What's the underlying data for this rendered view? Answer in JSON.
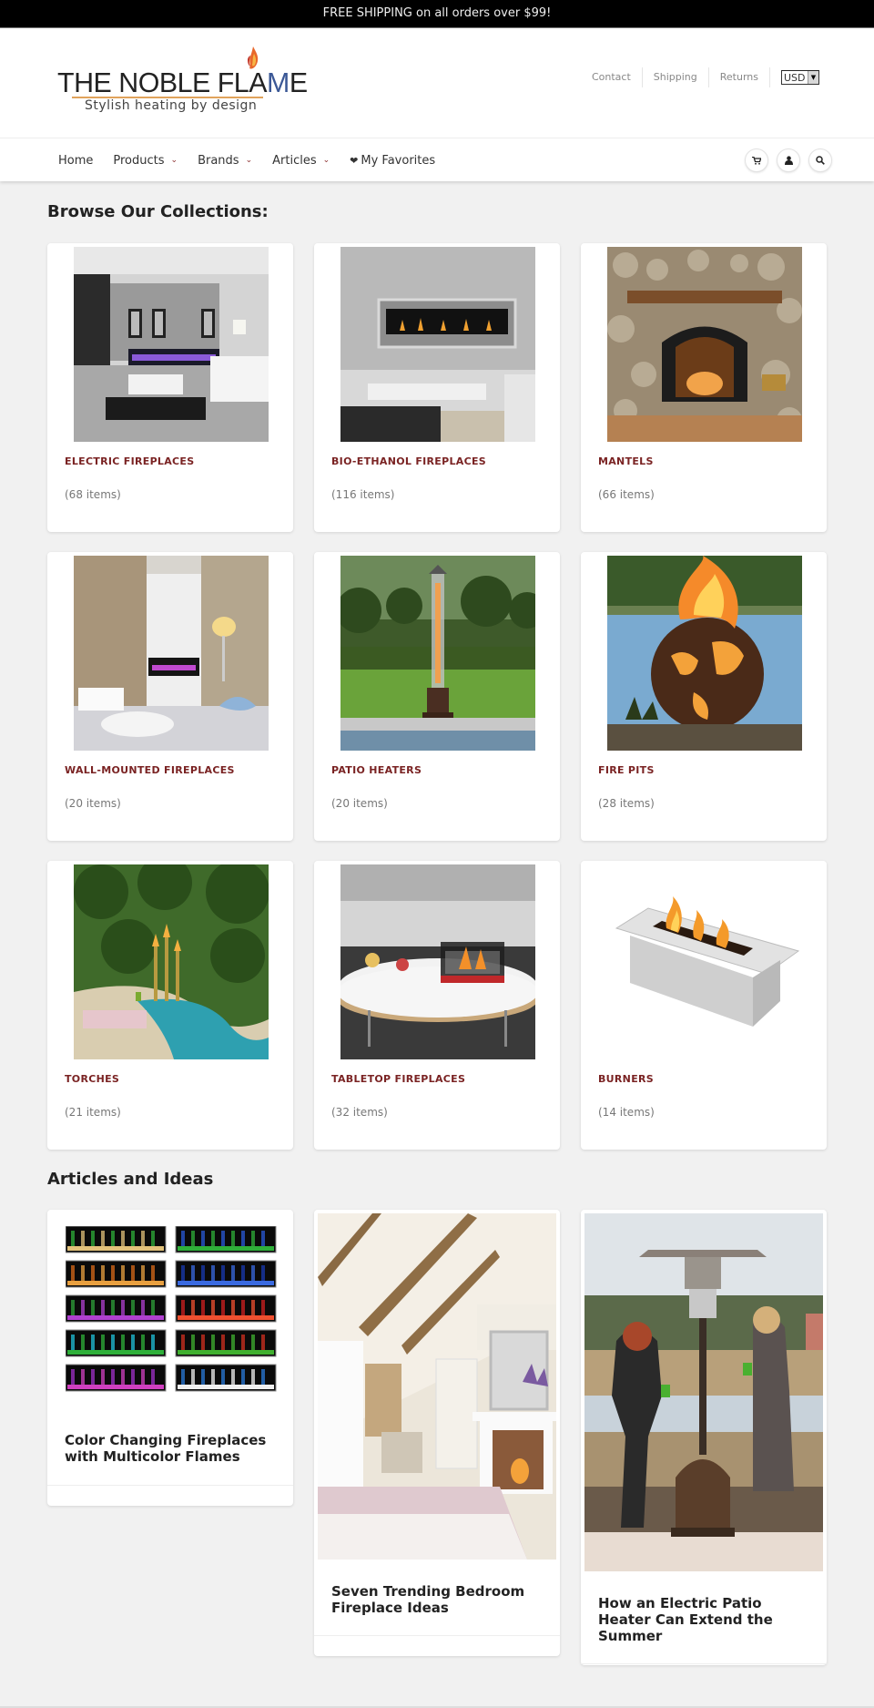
{
  "announcement": "FREE SHIPPING on all orders over $99!",
  "logo": {
    "title_main": "THE NOBLE FLA",
    "title_accent": "M",
    "title_end": "E",
    "tagline": "Stylish heating by design"
  },
  "utility_links": [
    "Contact",
    "Shipping",
    "Returns"
  ],
  "currency": {
    "selected": "USD"
  },
  "nav": {
    "items": [
      {
        "label": "Home",
        "dropdown": false
      },
      {
        "label": "Products",
        "dropdown": true
      },
      {
        "label": "Brands",
        "dropdown": true
      },
      {
        "label": "Articles",
        "dropdown": true
      },
      {
        "label": "My Favorites",
        "dropdown": false,
        "icon": "heart-icon"
      }
    ],
    "icons": [
      "cart-icon",
      "user-icon",
      "search-icon"
    ]
  },
  "collections": {
    "title": "Browse Our Collections:",
    "items": [
      {
        "name": "ELECTRIC FIREPLACES",
        "count": "(68 items)",
        "image": "electric-fireplace-living-room"
      },
      {
        "name": "BIO-ETHANOL FIREPLACES",
        "count": "(116 items)",
        "image": "bio-ethanol-wall-fireplace"
      },
      {
        "name": "MANTELS",
        "count": "(66 items)",
        "image": "stone-fireplace-mantel"
      },
      {
        "name": "WALL-MOUNTED FIREPLACES",
        "count": "(20 items)",
        "image": "wall-mounted-fireplace-room"
      },
      {
        "name": "PATIO HEATERS",
        "count": "(20 items)",
        "image": "patio-heater-garden"
      },
      {
        "name": "FIRE PITS",
        "count": "(28 items)",
        "image": "globe-fire-pit-lake"
      },
      {
        "name": "TORCHES",
        "count": "(21 items)",
        "image": "pool-torches"
      },
      {
        "name": "TABLETOP FIREPLACES",
        "count": "(32 items)",
        "image": "tabletop-fireplace"
      },
      {
        "name": "BURNERS",
        "count": "(14 items)",
        "image": "bio-ethanol-burner"
      }
    ]
  },
  "articles": {
    "title": "Articles and Ideas",
    "items": [
      {
        "title_line1": "Color Changing Fireplaces",
        "title_line2": "with Multicolor Flames",
        "image": "multicolor-flames-grid"
      },
      {
        "title_line1": "Seven Trending Bedroom",
        "title_line2": "Fireplace Ideas",
        "image": "bedroom-fireplace"
      },
      {
        "title_line1": "How an Electric Patio",
        "title_line2": "Heater Can Extend the",
        "title_line3": "Summer",
        "image": "patio-heater-women"
      }
    ]
  },
  "colors": {
    "accent": "#7a2323",
    "topbar": "#000000",
    "page_bg": "#f1f1f1"
  }
}
